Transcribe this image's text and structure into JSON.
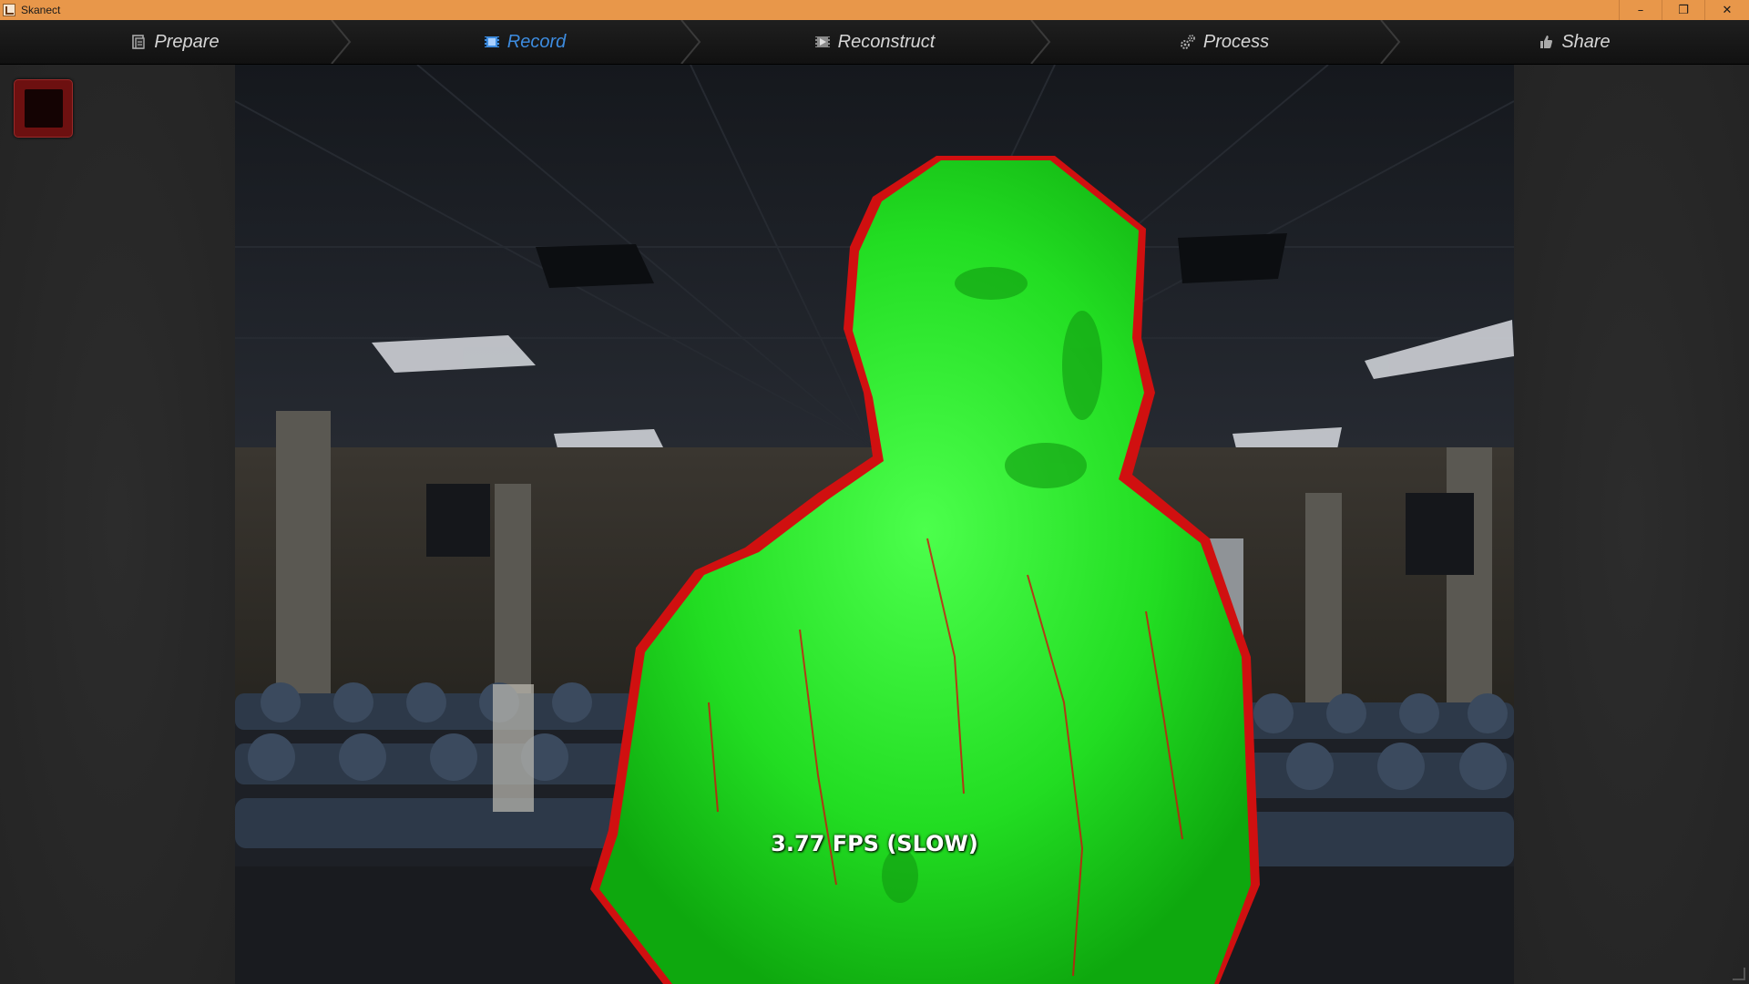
{
  "window": {
    "title": "Skanect",
    "controls": {
      "minimize": "–",
      "restore": "❐",
      "close": "✕"
    },
    "titlebar_color": "#e8974a"
  },
  "tabs": [
    {
      "label": "Prepare",
      "icon": "prepare-icon",
      "active": false
    },
    {
      "label": "Record",
      "icon": "record-icon",
      "active": true
    },
    {
      "label": "Reconstruct",
      "icon": "reconstruct-icon",
      "active": false
    },
    {
      "label": "Process",
      "icon": "gears-icon",
      "active": false
    },
    {
      "label": "Share",
      "icon": "thumbs-up-icon",
      "active": false
    }
  ],
  "record_button": {
    "icon": "stop-icon",
    "color": "#6d1010"
  },
  "viewport": {
    "fps_text": "3.77 FPS (SLOW)",
    "mesh_color": "#2ee62e",
    "edge_color": "#e01010"
  },
  "colors": {
    "active_tab": "#3d8ce0",
    "inactive_tab": "#d6d6d6"
  }
}
